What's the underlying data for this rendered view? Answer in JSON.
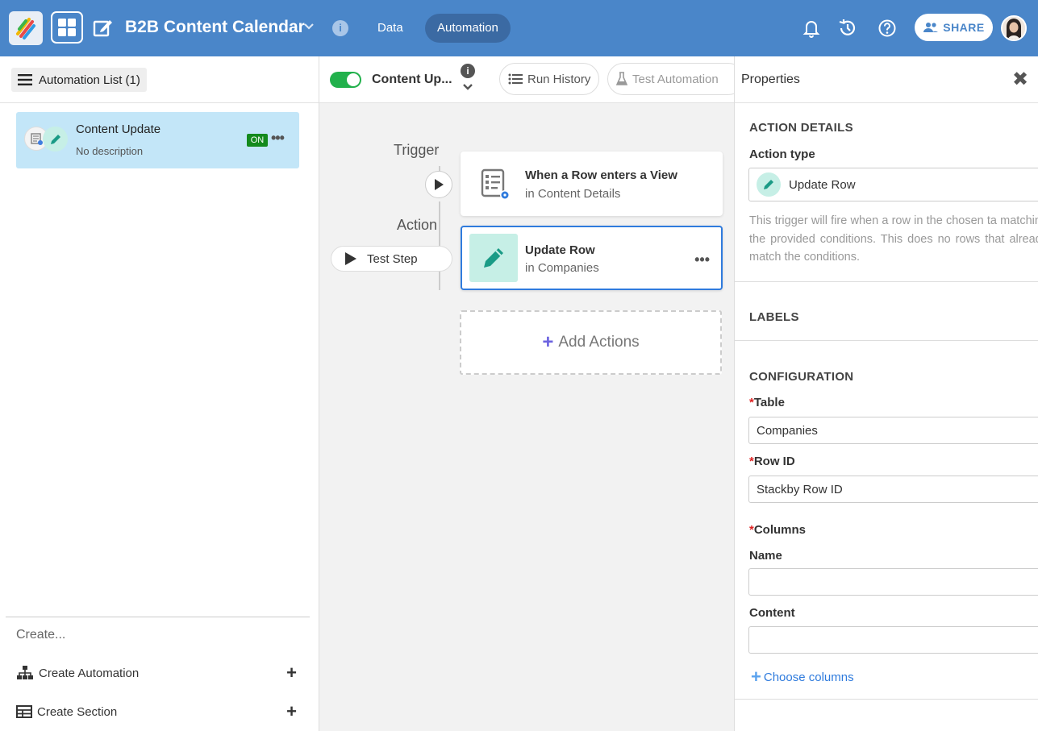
{
  "app": {
    "title": "B2B Content Calendar",
    "tabs": [
      "Data",
      "Automation"
    ],
    "share_label": "SHARE"
  },
  "sidebar": {
    "list_button": "Automation List (1)",
    "automation": {
      "title": "Content Update",
      "description": "No description",
      "status": "ON"
    },
    "create_heading": "Create...",
    "create_automation": "Create Automation",
    "create_section": "Create Section"
  },
  "canvas": {
    "automation_name": "Content Up...",
    "run_history": "Run History",
    "test_automation": "Test Automation",
    "trigger_label": "Trigger",
    "action_label": "Action",
    "test_step": "Test Step",
    "trigger_card": {
      "title": "When a Row enters a View",
      "subtitle": "in Content Details"
    },
    "action_card": {
      "title": "Update Row",
      "subtitle": "in Companies"
    },
    "add_actions": "Add Actions"
  },
  "properties": {
    "title": "Properties",
    "action_details": "ACTION DETAILS",
    "action_type_label": "Action type",
    "action_type_value": "Update Row",
    "help_text": "This trigger will fire when a row in the chosen ta matching the provided conditions. This does no rows that already match the conditions.",
    "labels": "LABELS",
    "configuration": "CONFIGURATION",
    "table_label": "Table",
    "table_value": "Companies",
    "rowid_label": "Row ID",
    "rowid_value": "Stackby Row ID",
    "columns_label": "Columns",
    "name_label": "Name",
    "name_value": "",
    "content_label": "Content",
    "content_value": "",
    "choose_columns": "Choose columns",
    "required_mark": "*"
  },
  "colors": {
    "topbar": "#4a86c9",
    "active_tab": "#3b6aa3",
    "selected_card": "#c3e6f8",
    "on_badge": "#148a1d",
    "toggle_on": "#22b14c",
    "accent_blue": "#2f7bdd",
    "teal_icon_bg": "#c6efe6"
  },
  "icons": [
    "stackby-logo",
    "grid-icon",
    "edit-icon",
    "info-icon",
    "bell-icon",
    "history-icon",
    "help-icon",
    "people-icon",
    "hamburger-icon",
    "pencil-icon",
    "table-view-icon",
    "more-icon",
    "play-icon",
    "list-icon",
    "flask-icon",
    "close-icon",
    "hierarchy-icon",
    "table-icon",
    "plus-icon",
    "chevron-down-icon"
  ]
}
